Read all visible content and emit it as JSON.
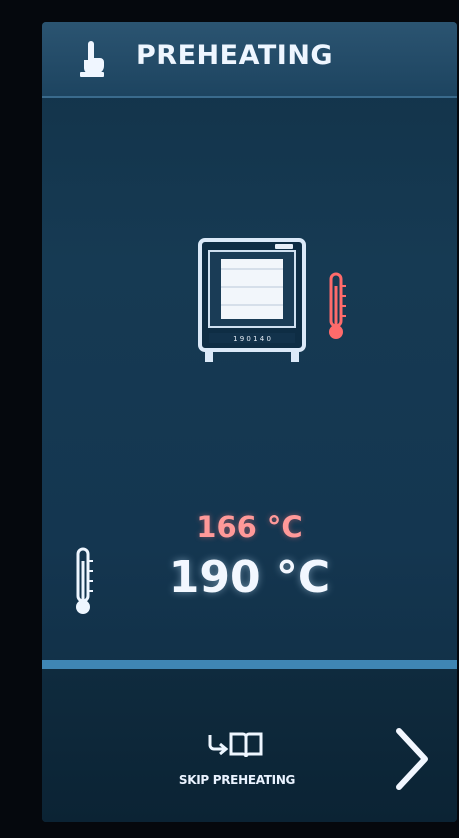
{
  "header": {
    "title": "PREHEATING",
    "icon": "hand-pointer-icon"
  },
  "oven": {
    "icon": "oven-icon",
    "panel_text": "1 9 0 1 4 0"
  },
  "temperatures": {
    "current": "166 °C",
    "setpoint": "190 °C",
    "current_color": "#ff9999",
    "setpoint_color": "#f2f7ff"
  },
  "footer": {
    "skip_label": "SKIP PREHEATING",
    "skip_icon": "skip-book-icon",
    "next_icon": "chevron-right-icon"
  },
  "colors": {
    "accent": "#3f86b4",
    "header_bg": "#2b5471",
    "screen_bg": "#163a53",
    "alert": "#ff6b6b"
  }
}
